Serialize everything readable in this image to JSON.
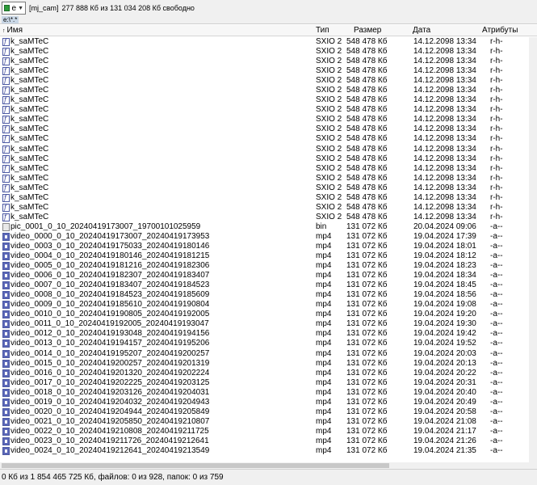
{
  "drive": {
    "letter": "e",
    "label": "[mj_cam]",
    "free_space": "277 888 Кб из 131 034 208 Кб свободно"
  },
  "path": "e:\\*.*",
  "columns": {
    "name": "Имя",
    "type": "Тип",
    "size": "Размер",
    "date": "Дата",
    "attr": "Атрибуты"
  },
  "files": [
    {
      "kind": "f",
      "name": "k_saMTeC",
      "type": "SXIO 2",
      "size": "548 478 Кб",
      "date": "14.12.2098 13:34",
      "attr": "r-h-"
    },
    {
      "kind": "f",
      "name": "k_saMTeC",
      "type": "SXIO 2",
      "size": "548 478 Кб",
      "date": "14.12.2098 13:34",
      "attr": "r-h-"
    },
    {
      "kind": "f",
      "name": "k_saMTeC",
      "type": "SXIO 2",
      "size": "548 478 Кб",
      "date": "14.12.2098 13:34",
      "attr": "r-h-"
    },
    {
      "kind": "f",
      "name": "k_saMTeC",
      "type": "SXIO 2",
      "size": "548 478 Кб",
      "date": "14.12.2098 13:34",
      "attr": "r-h-"
    },
    {
      "kind": "f",
      "name": "k_saMTeC",
      "type": "SXIO 2",
      "size": "548 478 Кб",
      "date": "14.12.2098 13:34",
      "attr": "r-h-"
    },
    {
      "kind": "f",
      "name": "k_saMTeC",
      "type": "SXIO 2",
      "size": "548 478 Кб",
      "date": "14.12.2098 13:34",
      "attr": "r-h-"
    },
    {
      "kind": "f",
      "name": "k_saMTeC",
      "type": "SXIO 2",
      "size": "548 478 Кб",
      "date": "14.12.2098 13:34",
      "attr": "r-h-"
    },
    {
      "kind": "f",
      "name": "k_saMTeC",
      "type": "SXIO 2",
      "size": "548 478 Кб",
      "date": "14.12.2098 13:34",
      "attr": "r-h-"
    },
    {
      "kind": "f",
      "name": "k_saMTeC",
      "type": "SXIO 2",
      "size": "548 478 Кб",
      "date": "14.12.2098 13:34",
      "attr": "r-h-"
    },
    {
      "kind": "f",
      "name": "k_saMTeC",
      "type": "SXIO 2",
      "size": "548 478 Кб",
      "date": "14.12.2098 13:34",
      "attr": "r-h-"
    },
    {
      "kind": "f",
      "name": "k_saMTeC",
      "type": "SXIO 2",
      "size": "548 478 Кб",
      "date": "14.12.2098 13:34",
      "attr": "r-h-"
    },
    {
      "kind": "f",
      "name": "k_saMTeC",
      "type": "SXIO 2",
      "size": "548 478 Кб",
      "date": "14.12.2098 13:34",
      "attr": "r-h-"
    },
    {
      "kind": "f",
      "name": "k_saMTeC",
      "type": "SXIO 2",
      "size": "548 478 Кб",
      "date": "14.12.2098 13:34",
      "attr": "r-h-"
    },
    {
      "kind": "f",
      "name": "k_saMTeC",
      "type": "SXIO 2",
      "size": "548 478 Кб",
      "date": "14.12.2098 13:34",
      "attr": "r-h-"
    },
    {
      "kind": "f",
      "name": "k_saMTeC",
      "type": "SXIO 2",
      "size": "548 478 Кб",
      "date": "14.12.2098 13:34",
      "attr": "r-h-"
    },
    {
      "kind": "f",
      "name": "k_saMTeC",
      "type": "SXIO 2",
      "size": "548 478 Кб",
      "date": "14.12.2098 13:34",
      "attr": "r-h-"
    },
    {
      "kind": "f",
      "name": "k_saMTeC",
      "type": "SXIO 2",
      "size": "548 478 Кб",
      "date": "14.12.2098 13:34",
      "attr": "r-h-"
    },
    {
      "kind": "f",
      "name": "k_saMTeC",
      "type": "SXIO 2",
      "size": "548 478 Кб",
      "date": "14.12.2098 13:34",
      "attr": "r-h-"
    },
    {
      "kind": "f",
      "name": "k_saMTeC",
      "type": "SXIO 2",
      "size": "548 478 Кб",
      "date": "14.12.2098 13:34",
      "attr": "r-h-"
    },
    {
      "kind": "pic",
      "name": "pic_0001_0_10_20240419173007_19700101025959",
      "type": "bin",
      "size": "131 072 Кб",
      "date": "20.04.2024 09:06",
      "attr": "-a--"
    },
    {
      "kind": "video",
      "name": "video_0000_0_10_20240419173007_20240419173953",
      "type": "mp4",
      "size": "131 072 Кб",
      "date": "19.04.2024 17:39",
      "attr": "-a--"
    },
    {
      "kind": "video",
      "name": "video_0003_0_10_20240419175033_20240419180146",
      "type": "mp4",
      "size": "131 072 Кб",
      "date": "19.04.2024 18:01",
      "attr": "-a--"
    },
    {
      "kind": "video",
      "name": "video_0004_0_10_20240419180146_20240419181215",
      "type": "mp4",
      "size": "131 072 Кб",
      "date": "19.04.2024 18:12",
      "attr": "-a--"
    },
    {
      "kind": "video",
      "name": "video_0005_0_10_20240419181216_20240419182306",
      "type": "mp4",
      "size": "131 072 Кб",
      "date": "19.04.2024 18:23",
      "attr": "-a--"
    },
    {
      "kind": "video",
      "name": "video_0006_0_10_20240419182307_20240419183407",
      "type": "mp4",
      "size": "131 072 Кб",
      "date": "19.04.2024 18:34",
      "attr": "-a--"
    },
    {
      "kind": "video",
      "name": "video_0007_0_10_20240419183407_20240419184523",
      "type": "mp4",
      "size": "131 072 Кб",
      "date": "19.04.2024 18:45",
      "attr": "-a--"
    },
    {
      "kind": "video",
      "name": "video_0008_0_10_20240419184523_20240419185609",
      "type": "mp4",
      "size": "131 072 Кб",
      "date": "19.04.2024 18:56",
      "attr": "-a--"
    },
    {
      "kind": "video",
      "name": "video_0009_0_10_20240419185610_20240419190804",
      "type": "mp4",
      "size": "131 072 Кб",
      "date": "19.04.2024 19:08",
      "attr": "-a--"
    },
    {
      "kind": "video",
      "name": "video_0010_0_10_20240419190805_20240419192005",
      "type": "mp4",
      "size": "131 072 Кб",
      "date": "19.04.2024 19:20",
      "attr": "-a--"
    },
    {
      "kind": "video",
      "name": "video_0011_0_10_20240419192005_20240419193047",
      "type": "mp4",
      "size": "131 072 Кб",
      "date": "19.04.2024 19:30",
      "attr": "-a--"
    },
    {
      "kind": "video",
      "name": "video_0012_0_10_20240419193048_20240419194156",
      "type": "mp4",
      "size": "131 072 Кб",
      "date": "19.04.2024 19:42",
      "attr": "-a--"
    },
    {
      "kind": "video",
      "name": "video_0013_0_10_20240419194157_20240419195206",
      "type": "mp4",
      "size": "131 072 Кб",
      "date": "19.04.2024 19:52",
      "attr": "-a--"
    },
    {
      "kind": "video",
      "name": "video_0014_0_10_20240419195207_20240419200257",
      "type": "mp4",
      "size": "131 072 Кб",
      "date": "19.04.2024 20:03",
      "attr": "-a--"
    },
    {
      "kind": "video",
      "name": "video_0015_0_10_20240419200257_20240419201319",
      "type": "mp4",
      "size": "131 072 Кб",
      "date": "19.04.2024 20:13",
      "attr": "-a--"
    },
    {
      "kind": "video",
      "name": "video_0016_0_10_20240419201320_20240419202224",
      "type": "mp4",
      "size": "131 072 Кб",
      "date": "19.04.2024 20:22",
      "attr": "-a--"
    },
    {
      "kind": "video",
      "name": "video_0017_0_10_20240419202225_20240419203125",
      "type": "mp4",
      "size": "131 072 Кб",
      "date": "19.04.2024 20:31",
      "attr": "-a--"
    },
    {
      "kind": "video",
      "name": "video_0018_0_10_20240419203126_20240419204031",
      "type": "mp4",
      "size": "131 072 Кб",
      "date": "19.04.2024 20:40",
      "attr": "-a--"
    },
    {
      "kind": "video",
      "name": "video_0019_0_10_20240419204032_20240419204943",
      "type": "mp4",
      "size": "131 072 Кб",
      "date": "19.04.2024 20:49",
      "attr": "-a--"
    },
    {
      "kind": "video",
      "name": "video_0020_0_10_20240419204944_20240419205849",
      "type": "mp4",
      "size": "131 072 Кб",
      "date": "19.04.2024 20:58",
      "attr": "-a--"
    },
    {
      "kind": "video",
      "name": "video_0021_0_10_20240419205850_20240419210807",
      "type": "mp4",
      "size": "131 072 Кб",
      "date": "19.04.2024 21:08",
      "attr": "-a--"
    },
    {
      "kind": "video",
      "name": "video_0022_0_10_20240419210808_20240419211725",
      "type": "mp4",
      "size": "131 072 Кб",
      "date": "19.04.2024 21:17",
      "attr": "-a--"
    },
    {
      "kind": "video",
      "name": "video_0023_0_10_20240419211726_20240419212641",
      "type": "mp4",
      "size": "131 072 Кб",
      "date": "19.04.2024 21:26",
      "attr": "-a--"
    },
    {
      "kind": "video",
      "name": "video_0024_0_10_20240419212641_20240419213549",
      "type": "mp4",
      "size": "131 072 Кб",
      "date": "19.04.2024 21:35",
      "attr": "-a--"
    }
  ],
  "status": "0 Кб из 1 854 465 725 Кб, файлов: 0 из 928, папок: 0 из 759"
}
